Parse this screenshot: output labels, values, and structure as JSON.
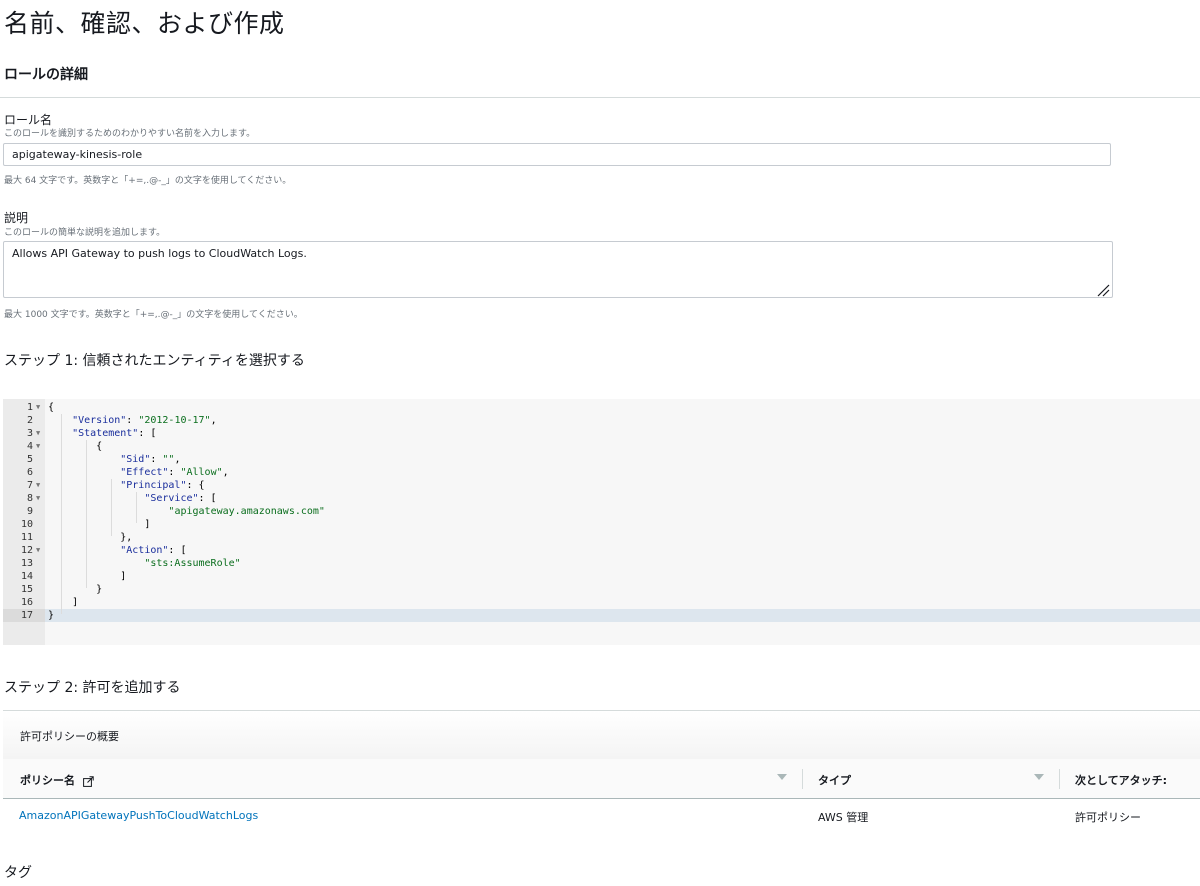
{
  "page": {
    "title": "名前、確認、および作成"
  },
  "role_details": {
    "section_title": "ロールの詳細",
    "role_name": {
      "label": "ロール名",
      "description": "このロールを識別するためのわかりやすい名前を入力します。",
      "value": "apigateway-kinesis-role",
      "hint": "最大 64 文字です。英数字と「+=,.@-_」の文字を使用してください。"
    },
    "description": {
      "label": "説明",
      "description": "このロールの簡単な説明を追加します。",
      "value": "Allows API Gateway to push logs to CloudWatch Logs.",
      "hint": "最大 1000 文字です。英数字と「+=,.@-_」の文字を使用してください。"
    }
  },
  "step1": {
    "title": "ステップ 1: 信頼されたエンティティを選択する",
    "code_lines": [
      {
        "num": "1",
        "fold": true,
        "text": "{"
      },
      {
        "num": "2",
        "fold": false,
        "text": "    \"Version\": \"2012-10-17\","
      },
      {
        "num": "3",
        "fold": true,
        "text": "    \"Statement\": ["
      },
      {
        "num": "4",
        "fold": true,
        "text": "        {"
      },
      {
        "num": "5",
        "fold": false,
        "text": "            \"Sid\": \"\","
      },
      {
        "num": "6",
        "fold": false,
        "text": "            \"Effect\": \"Allow\","
      },
      {
        "num": "7",
        "fold": true,
        "text": "            \"Principal\": {"
      },
      {
        "num": "8",
        "fold": true,
        "text": "                \"Service\": ["
      },
      {
        "num": "9",
        "fold": false,
        "text": "                    \"apigateway.amazonaws.com\""
      },
      {
        "num": "10",
        "fold": false,
        "text": "                ]"
      },
      {
        "num": "11",
        "fold": false,
        "text": "            },"
      },
      {
        "num": "12",
        "fold": true,
        "text": "            \"Action\": ["
      },
      {
        "num": "13",
        "fold": false,
        "text": "                \"sts:AssumeRole\""
      },
      {
        "num": "14",
        "fold": false,
        "text": "            ]"
      },
      {
        "num": "15",
        "fold": false,
        "text": "        }"
      },
      {
        "num": "16",
        "fold": false,
        "text": "    ]"
      },
      {
        "num": "17",
        "fold": false,
        "text": "}"
      }
    ],
    "active_line": 17
  },
  "step2": {
    "title": "ステップ 2: 許可を追加する",
    "table_title": "許可ポリシーの概要",
    "columns": [
      "ポリシー名",
      "タイプ",
      "次としてアタッチ:"
    ],
    "rows": [
      {
        "policy_name": "AmazonAPIGatewayPushToCloudWatchLogs",
        "type": "AWS 管理",
        "attached_as": "許可ポリシー"
      }
    ]
  },
  "tags": {
    "title": "タグ"
  },
  "icons": {
    "external_link": "external-link-icon",
    "sort": "sort-down-icon",
    "resize": "resize-grip-icon",
    "fold": "fold-arrow-icon"
  },
  "colors": {
    "link": "#0073bb",
    "string": "#0b6e1e",
    "key": "#1a2e9c",
    "active_line": "#dde6ee"
  }
}
